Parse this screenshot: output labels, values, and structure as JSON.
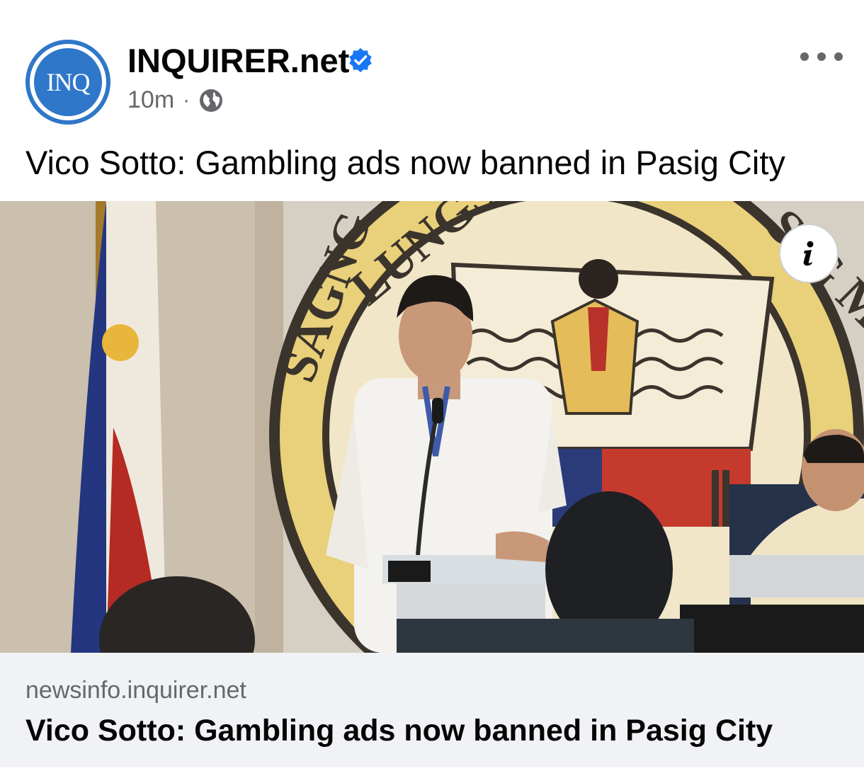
{
  "post": {
    "page_name": "INQUIRER.net",
    "avatar_text": "INQ",
    "timestamp": "10m",
    "separator": "·",
    "audience_icon": "globe-icon",
    "verified_icon": "verified-badge-icon",
    "caption": "Vico Sotto: Gambling ads now banned in Pasig City",
    "more_icon": "more-options-icon"
  },
  "photo": {
    "info_icon": "info-icon",
    "info_label": "i"
  },
  "link_card": {
    "domain": "newsinfo.inquirer.net",
    "title": "Vico Sotto: Gambling ads now banned in Pasig City"
  },
  "colors": {
    "brand_blue": "#2f77c9",
    "verified_blue": "#1877f2",
    "meta_gray": "#65676b",
    "card_bg": "#f0f2f5"
  }
}
